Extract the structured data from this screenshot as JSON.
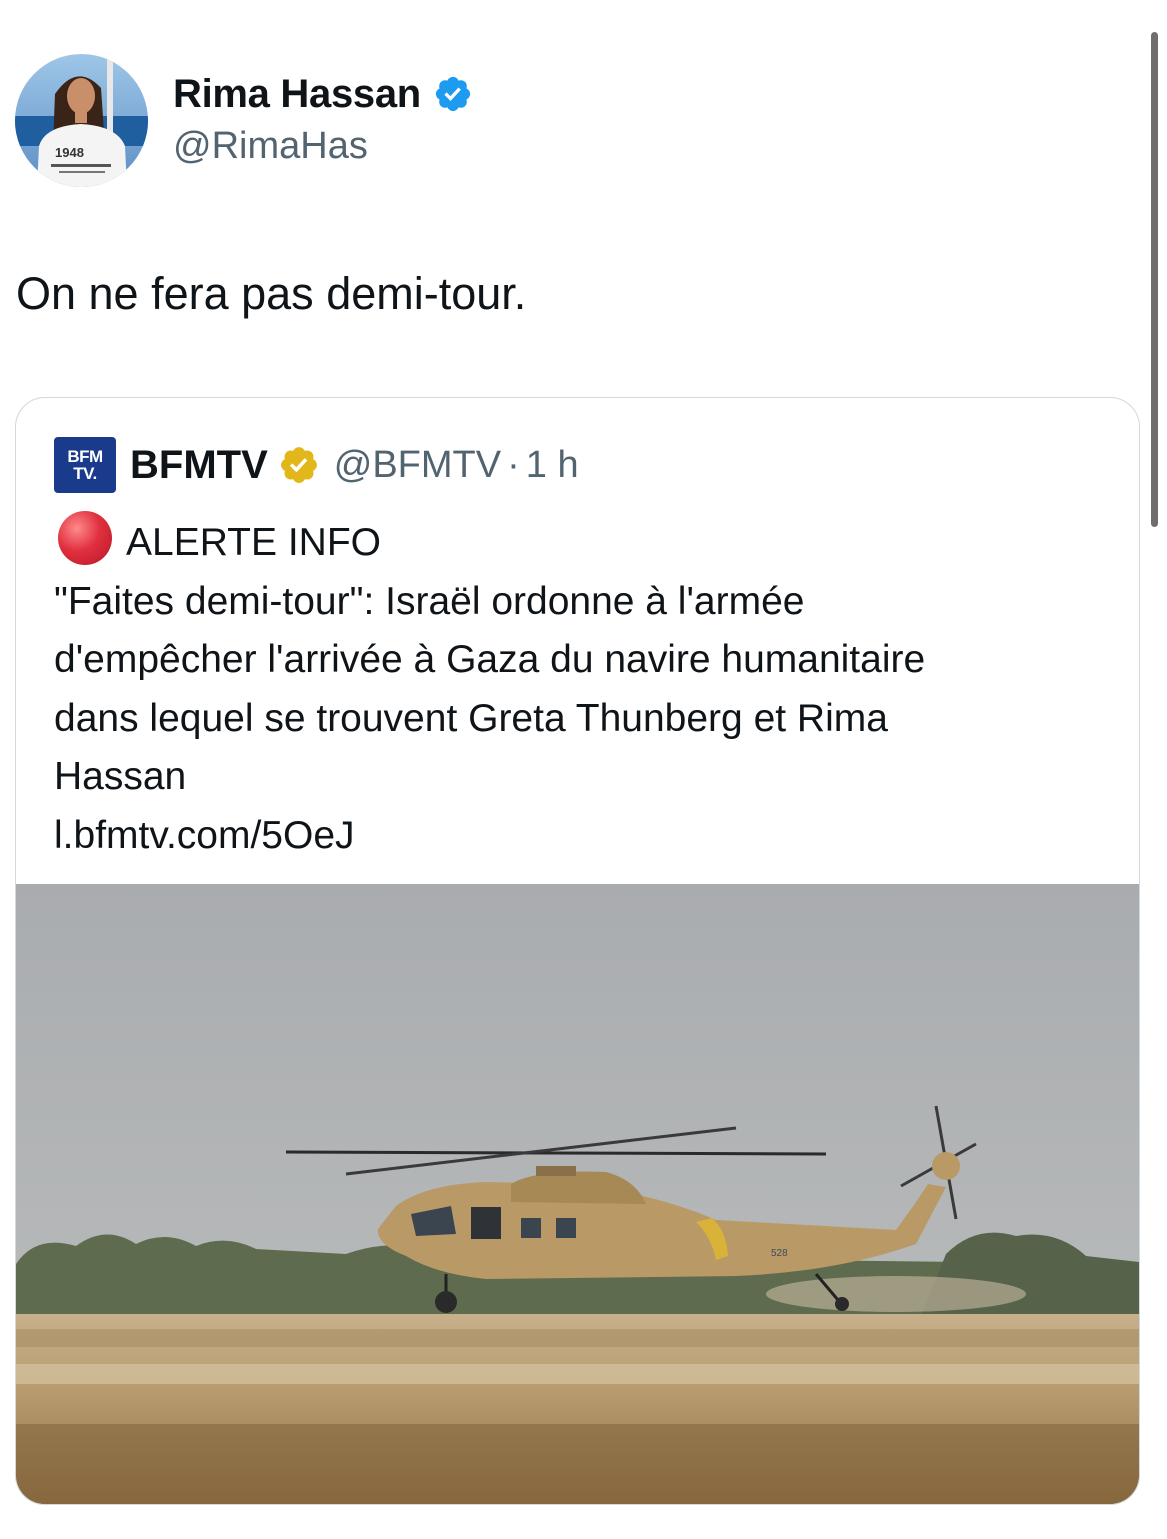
{
  "author": {
    "name": "Rima Hassan",
    "handle": "@RimaHas",
    "avatar_shirt_text": "1948"
  },
  "tweet": {
    "text": "On ne fera pas demi-tour."
  },
  "quote": {
    "logo_line1": "BFM",
    "logo_line2": "TV.",
    "name": "BFMTV",
    "handle": "@BFMTV",
    "separator": "·",
    "time": "1 h",
    "lines": [
      "ALERTE INFO",
      "\"Faites demi-tour\": Israël ordonne à l'armée",
      "d'empêcher l'arrivée à Gaza du navire humanitaire",
      "dans lequel se trouvent Greta Thunberg et Rima",
      "Hassan",
      "l.bfmtv.com/5OeJ"
    ],
    "image": {
      "tail_number": "528"
    }
  },
  "icons": {
    "verified_blue": "verified-badge-icon",
    "verified_gold": "gold-verified-badge-icon",
    "alert": "red-circle-icon"
  },
  "colors": {
    "verified_blue": "#1d9bf0",
    "verified_gold": "#e2b719",
    "alert_red": "#dd2e44",
    "secondary_text": "#536471",
    "border": "#cfd9de",
    "bfm_blue": "#1a3a8c"
  }
}
